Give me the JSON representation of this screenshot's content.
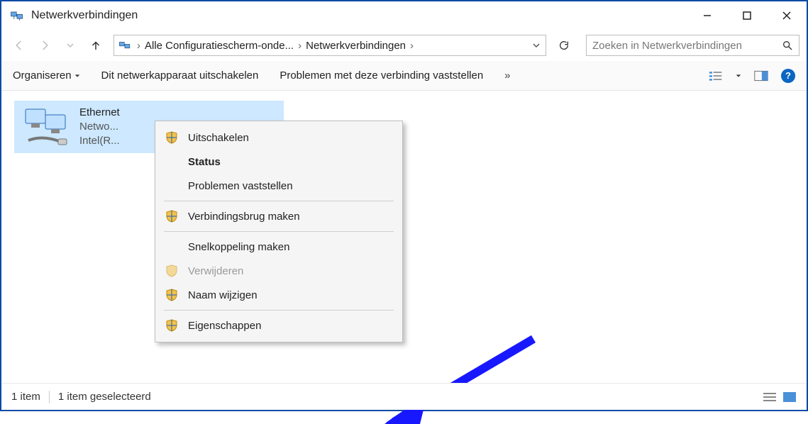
{
  "window": {
    "title": "Netwerkverbindingen"
  },
  "breadcrumb": {
    "seg1": "Alle Configuratiescherm-onde...",
    "seg2": "Netwerkverbindingen"
  },
  "search": {
    "placeholder": "Zoeken in Netwerkverbindingen"
  },
  "toolbar": {
    "organize": "Organiseren",
    "disable_device": "Dit netwerkapparaat uitschakelen",
    "diagnose": "Problemen met deze verbinding vaststellen"
  },
  "connection": {
    "name": "Ethernet",
    "line2": "Netwo...",
    "line3": "Intel(R..."
  },
  "context_menu": {
    "disable": "Uitschakelen",
    "status": "Status",
    "diagnose": "Problemen vaststellen",
    "bridge": "Verbindingsbrug maken",
    "shortcut": "Snelkoppeling maken",
    "delete": "Verwijderen",
    "rename": "Naam wijzigen",
    "properties": "Eigenschappen"
  },
  "statusbar": {
    "count": "1 item",
    "selected": "1 item geselecteerd"
  }
}
